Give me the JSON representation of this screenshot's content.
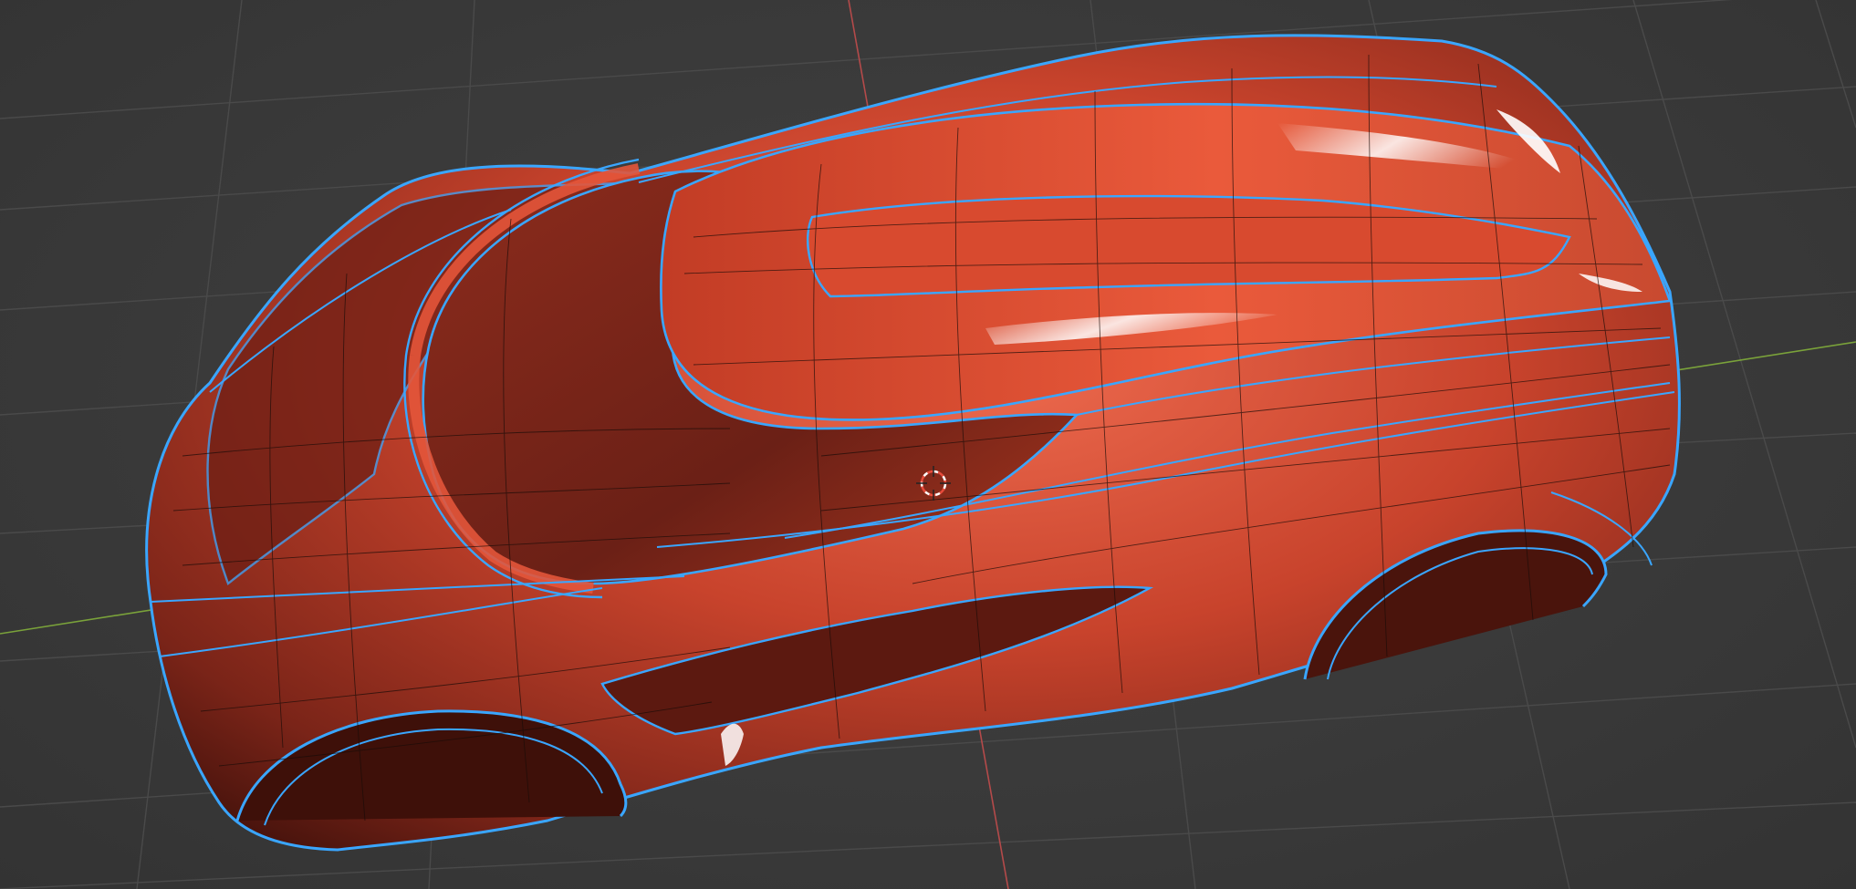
{
  "viewport": {
    "mode": "object-mode",
    "shading": "solid",
    "overlay": "wireframe-edges"
  },
  "scene": {
    "object": "car-body-mesh",
    "selected": true,
    "colors": {
      "background": "#3a3a3a",
      "grid_line": "#4c4c4c",
      "x_axis": "#b44a4a",
      "y_axis": "#7aa23a",
      "body_base": "#c8432c",
      "body_highlight": "#ff8a6a",
      "body_shadow": "#5a1a12",
      "selection_outline": "#3aa6ff",
      "wire": "#1a0c08"
    }
  },
  "cursor_3d": {
    "icon": "3d-cursor-icon",
    "colors": [
      "#e84a3a",
      "#ffffff"
    ]
  }
}
